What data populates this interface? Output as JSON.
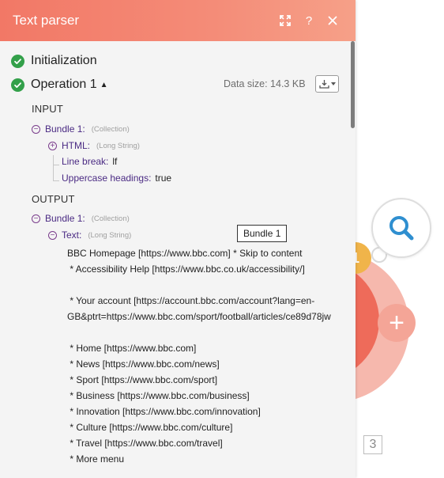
{
  "panel": {
    "title": "Text parser",
    "expand_icon": "expand-icon",
    "help_label": "?",
    "close_icon": "close-icon"
  },
  "sections": {
    "initialization": "Initialization",
    "operation": "Operation 1",
    "data_size": "Data size: 14.3 KB"
  },
  "input": {
    "heading": "INPUT",
    "bundle_label": "Bundle 1:",
    "bundle_type": "(Collection)",
    "html_label": "HTML:",
    "html_type": "(Long String)",
    "line_break_label": "Line break:",
    "line_break_value": "lf",
    "uppercase_label": "Uppercase headings:",
    "uppercase_value": "true"
  },
  "output": {
    "heading": "OUTPUT",
    "bundle_label": "Bundle 1:",
    "bundle_type": "(Collection)",
    "text_label": "Text:",
    "text_type": "(Long String)",
    "text_value": "BBC Homepage [https://www.bbc.com] * Skip to content\n * Accessibility Help [https://www.bbc.co.uk/accessibility/]\n\n * Your account [https://account.bbc.com/account?lang=en-\nGB&ptrt=https://www.bbc.com/sport/football/articles/ce89d78jw\n\n * Home [https://www.bbc.com]\n * News [https://www.bbc.com/news]\n * Sport [https://www.bbc.com/sport]\n * Business [https://www.bbc.com/business]\n * Innovation [https://www.bbc.com/innovation]\n * Culture [https://www.bbc.com/culture]\n * Travel [https://www.bbc.com/travel]\n * More menu"
  },
  "tooltip": "Bundle 1",
  "canvas": {
    "badge": "1",
    "add_label": "+",
    "ops_count": "3"
  },
  "colors": {
    "header_start": "#f27866",
    "header_end": "#f6a088",
    "success": "#33a04a",
    "key_purple": "#4a2a83",
    "module_red": "#ee6b5a",
    "search_blue": "#2f8fd0"
  }
}
